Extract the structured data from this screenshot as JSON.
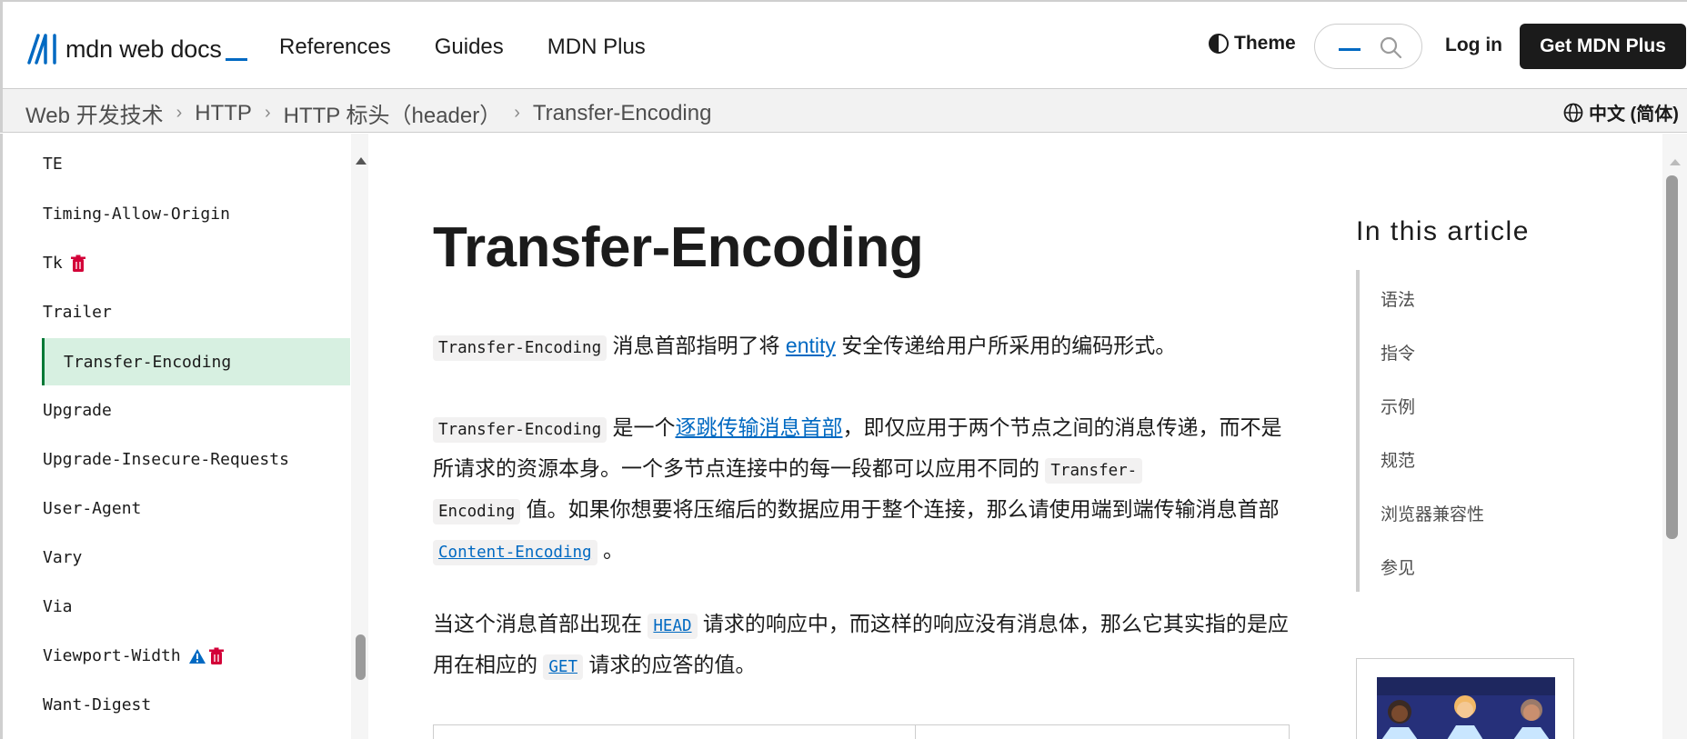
{
  "header": {
    "logo_text": "mdn web docs",
    "nav": [
      "References",
      "Guides",
      "MDN Plus"
    ],
    "theme_label": "Theme",
    "login_label": "Log in",
    "plus_label": "Get MDN Plus"
  },
  "breadcrumb": {
    "items": [
      "Web 开发技术",
      "HTTP",
      "HTTP 标头（header）",
      "Transfer-Encoding"
    ],
    "language": "中文 (简体)"
  },
  "sidebar": {
    "items": [
      {
        "label": "TE",
        "icons": []
      },
      {
        "label": "Timing-Allow-Origin",
        "icons": []
      },
      {
        "label": "Tk",
        "icons": [
          "trash-icon"
        ]
      },
      {
        "label": "Trailer",
        "icons": []
      },
      {
        "label": "Transfer-Encoding",
        "icons": [],
        "active": true
      },
      {
        "label": "Upgrade",
        "icons": []
      },
      {
        "label": "Upgrade-Insecure-Requests",
        "icons": []
      },
      {
        "label": "User-Agent",
        "icons": []
      },
      {
        "label": "Vary",
        "icons": []
      },
      {
        "label": "Via",
        "icons": []
      },
      {
        "label": "Viewport-Width",
        "icons": [
          "warning-icon",
          "trash-icon"
        ]
      },
      {
        "label": "Want-Digest",
        "icons": []
      }
    ]
  },
  "article": {
    "title": "Transfer-Encoding",
    "p1": {
      "code": "Transfer-Encoding",
      "text_before_link": " 消息首部指明了将 ",
      "link": "entity",
      "text_after_link": " 安全传递给用户所采用的编码形式。"
    },
    "p2": {
      "code1": "Transfer-Encoding",
      "t1": " 是一个",
      "link": "逐跳传输消息首部",
      "t2": "，即仅应用于两个节点之间的消息传递，而不是所请求的资源本身。一个多节点连接中的每一段都可以应用不同的 ",
      "code2a": "Transfer-",
      "code2b": "Encoding",
      "t3": " 值。如果你想要将压缩后的数据应用于整个连接，那么请使用端到端传输消息首部 ",
      "code3": "Content-Encoding",
      "t4": " 。"
    },
    "p3": {
      "t1": "当这个消息首部出现在 ",
      "code1": "HEAD",
      "t2": " 请求的响应中，而这样的响应没有消息体，那么它其实指的是应用在相应的 ",
      "code2": "GET",
      "t3": " 请求的应答的值。"
    }
  },
  "toc": {
    "title": "In this article",
    "items": [
      "语法",
      "指令",
      "示例",
      "规范",
      "浏览器兼容性",
      "参见"
    ]
  },
  "colors": {
    "link": "#0069c2",
    "active_bg": "#d7f0e1",
    "active_border": "#007936",
    "button_bg": "#1b1b1b",
    "deprecated": "#d30038",
    "experimental": "#0069c2"
  }
}
